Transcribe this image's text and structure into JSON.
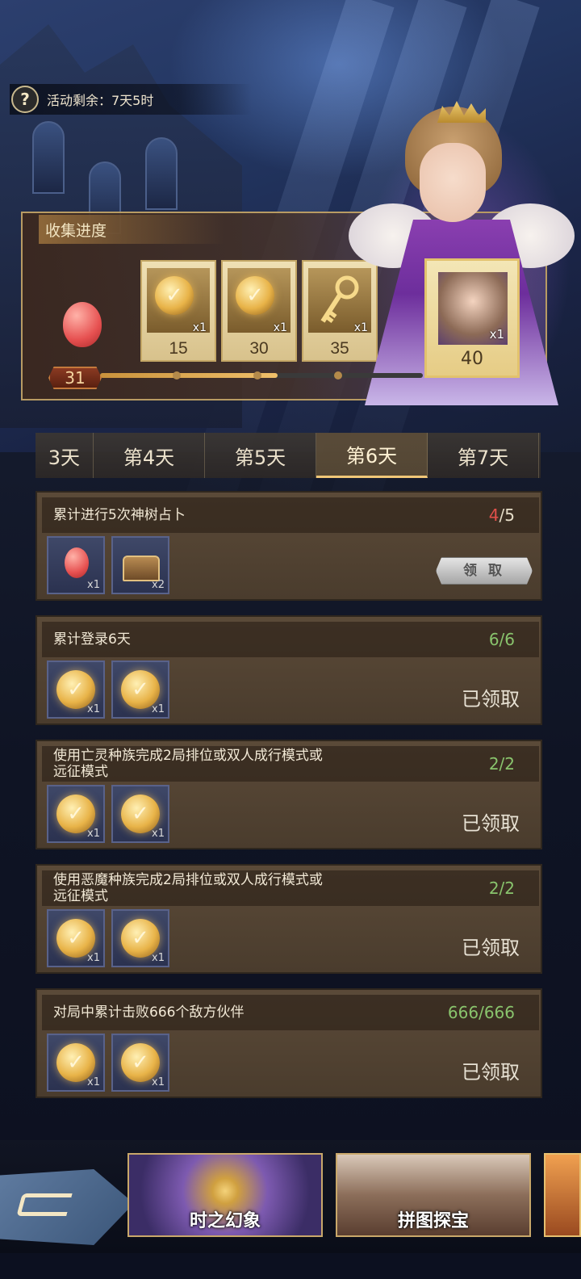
{
  "timer": {
    "label": "活动剩余：7天5时",
    "help_icon": "?"
  },
  "collection": {
    "title": "收集进度",
    "current_points": "31",
    "progress_fraction": 0.55,
    "tiers": [
      {
        "points": "15",
        "qty": "x1",
        "icon": "checkmark-medal-icon"
      },
      {
        "points": "30",
        "qty": "x1",
        "icon": "checkmark-medal-icon"
      },
      {
        "points": "35",
        "qty": "x1",
        "icon": "golden-key-icon"
      },
      {
        "points": "40",
        "qty": "x1",
        "icon": "hero-portrait-icon"
      }
    ]
  },
  "tabs": [
    "3天",
    "第4天",
    "第5天",
    "第6天",
    "第7天"
  ],
  "active_tab": 3,
  "tasks": [
    {
      "title": "累计进行5次神树占卜",
      "progress_current": "4",
      "progress_total": "/5",
      "status": "claim",
      "button_label": "领 取",
      "rewards": [
        {
          "icon": "balloon-icon",
          "qty": "x1"
        },
        {
          "icon": "treasure-chest-icon",
          "qty": "x2"
        }
      ]
    },
    {
      "title": "累计登录6天",
      "progress": "6/6",
      "status_label": "已领取",
      "rewards": [
        {
          "icon": "checkmark-medal-icon",
          "qty": "x1"
        },
        {
          "icon": "checkmark-medal-icon",
          "qty": "x1"
        }
      ]
    },
    {
      "title_line1": "使用亡灵种族完成2局排位或双人成行模式或",
      "title_line2": "远征模式",
      "progress": "2/2",
      "status_label": "已领取",
      "rewards": [
        {
          "icon": "checkmark-medal-icon",
          "qty": "x1"
        },
        {
          "icon": "checkmark-medal-icon",
          "qty": "x1"
        }
      ]
    },
    {
      "title_line1": "使用恶魔种族完成2局排位或双人成行模式或",
      "title_line2": "远征模式",
      "progress": "2/2",
      "status_label": "已领取",
      "rewards": [
        {
          "icon": "checkmark-medal-icon",
          "qty": "x1"
        },
        {
          "icon": "checkmark-medal-icon",
          "qty": "x1"
        }
      ]
    },
    {
      "title": "对局中累计击败666个敌方伙伴",
      "progress": "666/666",
      "status_label": "已领取",
      "rewards": [
        {
          "icon": "checkmark-medal-icon",
          "qty": "x1"
        },
        {
          "icon": "checkmark-medal-icon",
          "qty": "x1"
        }
      ]
    }
  ],
  "bottom": {
    "banners": [
      {
        "label": "时之幻象"
      },
      {
        "label": "拼图探宝"
      }
    ]
  },
  "colors": {
    "progress_red": "#e0504a",
    "progress_green": "#89c46d",
    "accent_gold": "#f0c778"
  }
}
